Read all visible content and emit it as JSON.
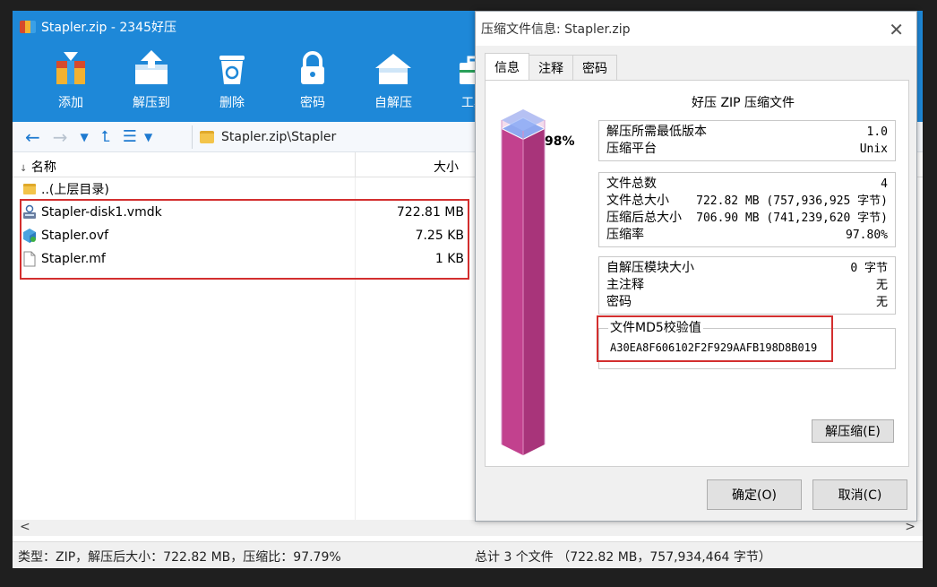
{
  "main": {
    "title": "Stapler.zip - 2345好压",
    "toolbar": [
      {
        "label": "添加",
        "icon": "add-archive-icon"
      },
      {
        "label": "解压到",
        "icon": "extract-icon"
      },
      {
        "label": "删除",
        "icon": "recycle-bin-icon"
      },
      {
        "label": "密码",
        "icon": "lock-icon"
      },
      {
        "label": "自解压",
        "icon": "self-extract-icon"
      },
      {
        "label": "工具",
        "icon": "toolbox-icon"
      }
    ],
    "path": "Stapler.zip\\Stapler",
    "columns": {
      "name": "名称",
      "size": "大小"
    },
    "parent_label": "..(上层目录)",
    "files": [
      {
        "name": "Stapler-disk1.vmdk",
        "size": "722.81 MB",
        "icon": "disk-image-icon"
      },
      {
        "name": "Stapler.ovf",
        "size": "7.25 KB",
        "icon": "package-icon"
      },
      {
        "name": "Stapler.mf",
        "size": "1 KB",
        "icon": "file-icon"
      }
    ],
    "status_left": "类型：ZIP，解压后大小：722.82 MB，压缩比：97.79%",
    "status_right": "总计 3 个文件 （722.82 MB，757,934,464 字节）"
  },
  "dialog": {
    "title": "压缩文件信息: Stapler.zip",
    "tabs": [
      "信息",
      "注释",
      "密码"
    ],
    "heading": "好压 ZIP 压缩文件",
    "ratio_label": "98%",
    "ratio_value": 0.98,
    "group1": [
      {
        "k": "解压所需最低版本",
        "v": "1.0"
      },
      {
        "k": "压缩平台",
        "v": "Unix"
      }
    ],
    "group2": [
      {
        "k": "文件总数",
        "v": "4"
      },
      {
        "k": "文件总大小",
        "v": "722.82 MB (757,936,925 字节)"
      },
      {
        "k": "压缩后总大小",
        "v": "706.90 MB (741,239,620 字节)"
      },
      {
        "k": "压缩率",
        "v": "97.80%"
      }
    ],
    "group3": [
      {
        "k": "自解压模块大小",
        "v": "0 字节"
      },
      {
        "k": "主注释",
        "v": "无"
      },
      {
        "k": "密码",
        "v": "无"
      }
    ],
    "md5_label": "文件MD5校验值",
    "md5_value": "A30EA8F606102F2F929AAFB198D8B019",
    "extract_button": "解压缩(E)",
    "ok_button": "确定(O)",
    "cancel_button": "取消(C)"
  },
  "colors": {
    "accent": "#1e88d8",
    "highlight": "#d32f2f",
    "bar": "#c2418e"
  }
}
